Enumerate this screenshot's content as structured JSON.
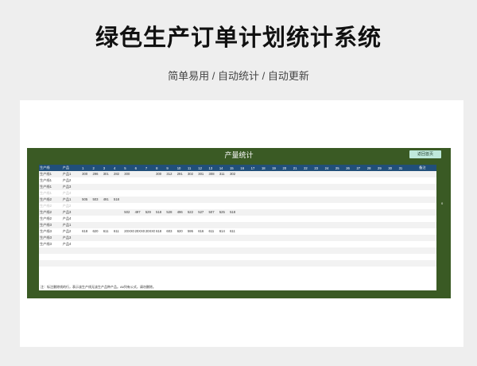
{
  "page": {
    "title": "绿色生产订单计划统计系统",
    "subtitle": "简单易用 / 自动统计 / 自动更新"
  },
  "sheet": {
    "title": "产量统计",
    "back_button": "返回首页",
    "note": "注：标注删除线的行，表示该生产线无该生产品种产品。A6列有公式，请勿删除。",
    "edge_mark": "0",
    "headers": [
      "生产线",
      "产品",
      "1",
      "2",
      "3",
      "4",
      "5",
      "6",
      "7",
      "8",
      "9",
      "10",
      "11",
      "12",
      "13",
      "14",
      "15",
      "16",
      "17",
      "18",
      "19",
      "20",
      "21",
      "22",
      "23",
      "24",
      "25",
      "26",
      "27",
      "28",
      "29",
      "30",
      "31",
      "",
      "备注"
    ],
    "rows": [
      {
        "muted": false,
        "cells": [
          "生产线1",
          "产品1",
          "300",
          "296",
          "301",
          "282",
          "300",
          "",
          "",
          "300",
          "312",
          "291",
          "302",
          "301",
          "308",
          "311",
          "302"
        ]
      },
      {
        "muted": false,
        "cells": [
          "生产线1",
          "产品2"
        ]
      },
      {
        "muted": false,
        "cells": [
          "生产线1",
          "产品3"
        ]
      },
      {
        "muted": true,
        "cells": [
          "生产线1",
          "产品4"
        ]
      },
      {
        "muted": false,
        "cells": [
          "生产线2",
          "产品1",
          "505",
          "503",
          "491",
          "518"
        ]
      },
      {
        "muted": true,
        "cells": [
          "生产线2",
          "产品2"
        ]
      },
      {
        "muted": false,
        "cells": [
          "生产线2",
          "产品3",
          "",
          "",
          "",
          "",
          "502",
          "497",
          "529",
          "518",
          "528",
          "496",
          "522",
          "527",
          "507",
          "525",
          "518"
        ]
      },
      {
        "muted": false,
        "cells": [
          "生产线2",
          "产品4"
        ]
      },
      {
        "muted": false,
        "cells": [
          "生产线3",
          "产品1"
        ]
      },
      {
        "muted": false,
        "cells": [
          "生产线3",
          "产品2",
          "618",
          "620",
          "611",
          "611",
          "20XX0",
          "20XX0",
          "20XX0",
          "618",
          "603",
          "620",
          "595",
          "616",
          "611",
          "614",
          "611"
        ]
      },
      {
        "muted": false,
        "cells": [
          "生产线3",
          "产品3"
        ]
      },
      {
        "muted": false,
        "cells": [
          "生产线3",
          "产品4"
        ]
      },
      {
        "muted": false,
        "cells": []
      },
      {
        "muted": false,
        "cells": []
      },
      {
        "muted": false,
        "cells": []
      },
      {
        "muted": false,
        "cells": []
      }
    ]
  },
  "colors": {
    "frame": "#3a5a24",
    "header": "#214f7a",
    "button": "#bfe9dc"
  }
}
